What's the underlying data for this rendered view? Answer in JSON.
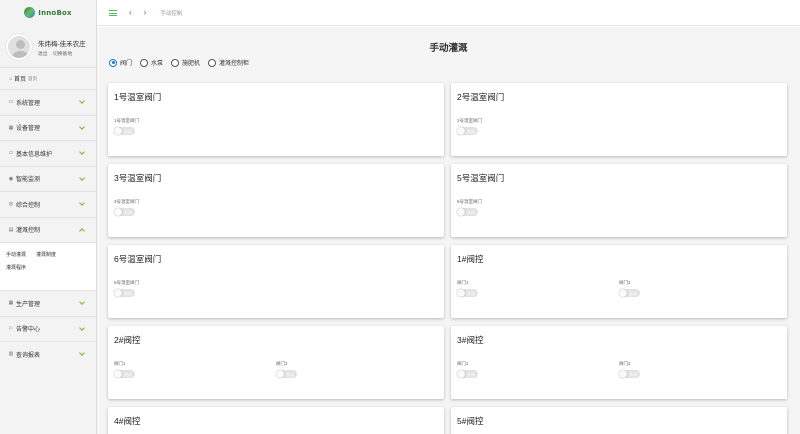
{
  "app": {
    "logo_text": "InnoBox"
  },
  "user": {
    "name": "朱炜梅-佳禾农庄",
    "logout": "退出",
    "switch_base": "切换基地"
  },
  "topbar": {
    "breadcrumb": "手动控制"
  },
  "sidebar": {
    "home": {
      "label": "首页",
      "sub": "首页"
    },
    "items": [
      {
        "label": "系统管理",
        "icon": "desktop-icon"
      },
      {
        "label": "设备管理",
        "icon": "device-icon"
      },
      {
        "label": "基本信息维护",
        "icon": "desktop-icon"
      },
      {
        "label": "智能监测",
        "icon": "eye-icon"
      },
      {
        "label": "综合控制",
        "icon": "control-icon"
      },
      {
        "label": "灌溉控制",
        "icon": "irrigation-icon"
      },
      {
        "label": "生产管理",
        "icon": "production-icon"
      },
      {
        "label": "告警中心",
        "icon": "alarm-icon"
      },
      {
        "label": "查询报表",
        "icon": "chart-icon"
      }
    ],
    "submenu": [
      "手动灌溉",
      "灌溉制度",
      "灌溉程序"
    ]
  },
  "main": {
    "title": "手动灌溉",
    "radio_options": [
      "阀门",
      "水泵",
      "施肥机",
      "灌溉控制柜"
    ],
    "radio_selected": 0,
    "toggle_off_label": "关闭",
    "cards": [
      {
        "title": "1号温室阀门",
        "controls": [
          "1号温室阀门"
        ]
      },
      {
        "title": "2号温室阀门",
        "controls": [
          "2号温室阀门"
        ]
      },
      {
        "title": "3号温室阀门",
        "controls": [
          "3号温室阀门"
        ]
      },
      {
        "title": "5号温室阀门",
        "controls": [
          "5号温室阀门"
        ]
      },
      {
        "title": "6号温室阀门",
        "controls": [
          "6号温室阀门"
        ]
      },
      {
        "title": "1#阀控",
        "controls": [
          "阀门1",
          "阀门2"
        ]
      },
      {
        "title": "2#阀控",
        "controls": [
          "阀门1",
          "阀门2"
        ]
      },
      {
        "title": "3#阀控",
        "controls": [
          "阀门1",
          "阀门2"
        ]
      },
      {
        "title": "4#阀控",
        "controls": []
      },
      {
        "title": "5#阀控",
        "controls": []
      }
    ]
  }
}
